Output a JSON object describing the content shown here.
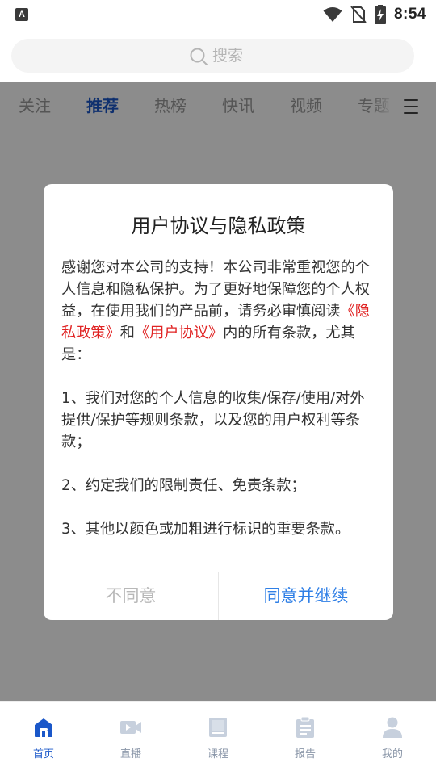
{
  "status_bar": {
    "app_icon_letter": "A",
    "time": "8:54",
    "icons": [
      "wifi-icon",
      "no-sim-icon",
      "battery-charging-icon"
    ]
  },
  "search": {
    "placeholder": "搜索",
    "icon": "search-icon"
  },
  "tabs": [
    {
      "label": "关注",
      "active": false
    },
    {
      "label": "推荐",
      "active": true
    },
    {
      "label": "热榜",
      "active": false
    },
    {
      "label": "快讯",
      "active": false
    },
    {
      "label": "视频",
      "active": false
    },
    {
      "label": "专题",
      "active": false
    }
  ],
  "tab_menu_icon": "menu-icon",
  "dialog": {
    "title": "用户协议与隐私政策",
    "intro_before": "感谢您对本公司的支持！本公司非常重视您的个人信息和隐私保护。为了更好地保障您的个人权益，在使用我们的产品前，请务必审慎阅读",
    "privacy_link": "《隐私政策》",
    "intro_middle": "和",
    "agreement_link": "《用户协议》",
    "intro_after": "内的所有条款，尤其是：",
    "clauses": [
      "1、我们对您的个人信息的收集/保存/使用/对外提供/保护等规则条款，以及您的用户权利等条款；",
      "2、约定我们的限制责任、免责条款；",
      "3、其他以颜色或加粗进行标识的重要条款。"
    ],
    "disagree_label": "不同意",
    "agree_label": "同意并继续"
  },
  "bottom_nav": [
    {
      "label": "首页",
      "icon": "home-icon",
      "active": true
    },
    {
      "label": "直播",
      "icon": "video-camera-icon",
      "active": false
    },
    {
      "label": "课程",
      "icon": "book-icon",
      "active": false
    },
    {
      "label": "报告",
      "icon": "report-clipboard-icon",
      "active": false
    },
    {
      "label": "我的",
      "icon": "user-icon",
      "active": false
    }
  ],
  "colors": {
    "accent_blue": "#1a57c9",
    "agree_blue": "#2f7fe6",
    "link_red": "#e02323",
    "overlay": "rgba(0,0,0,0.45)"
  }
}
